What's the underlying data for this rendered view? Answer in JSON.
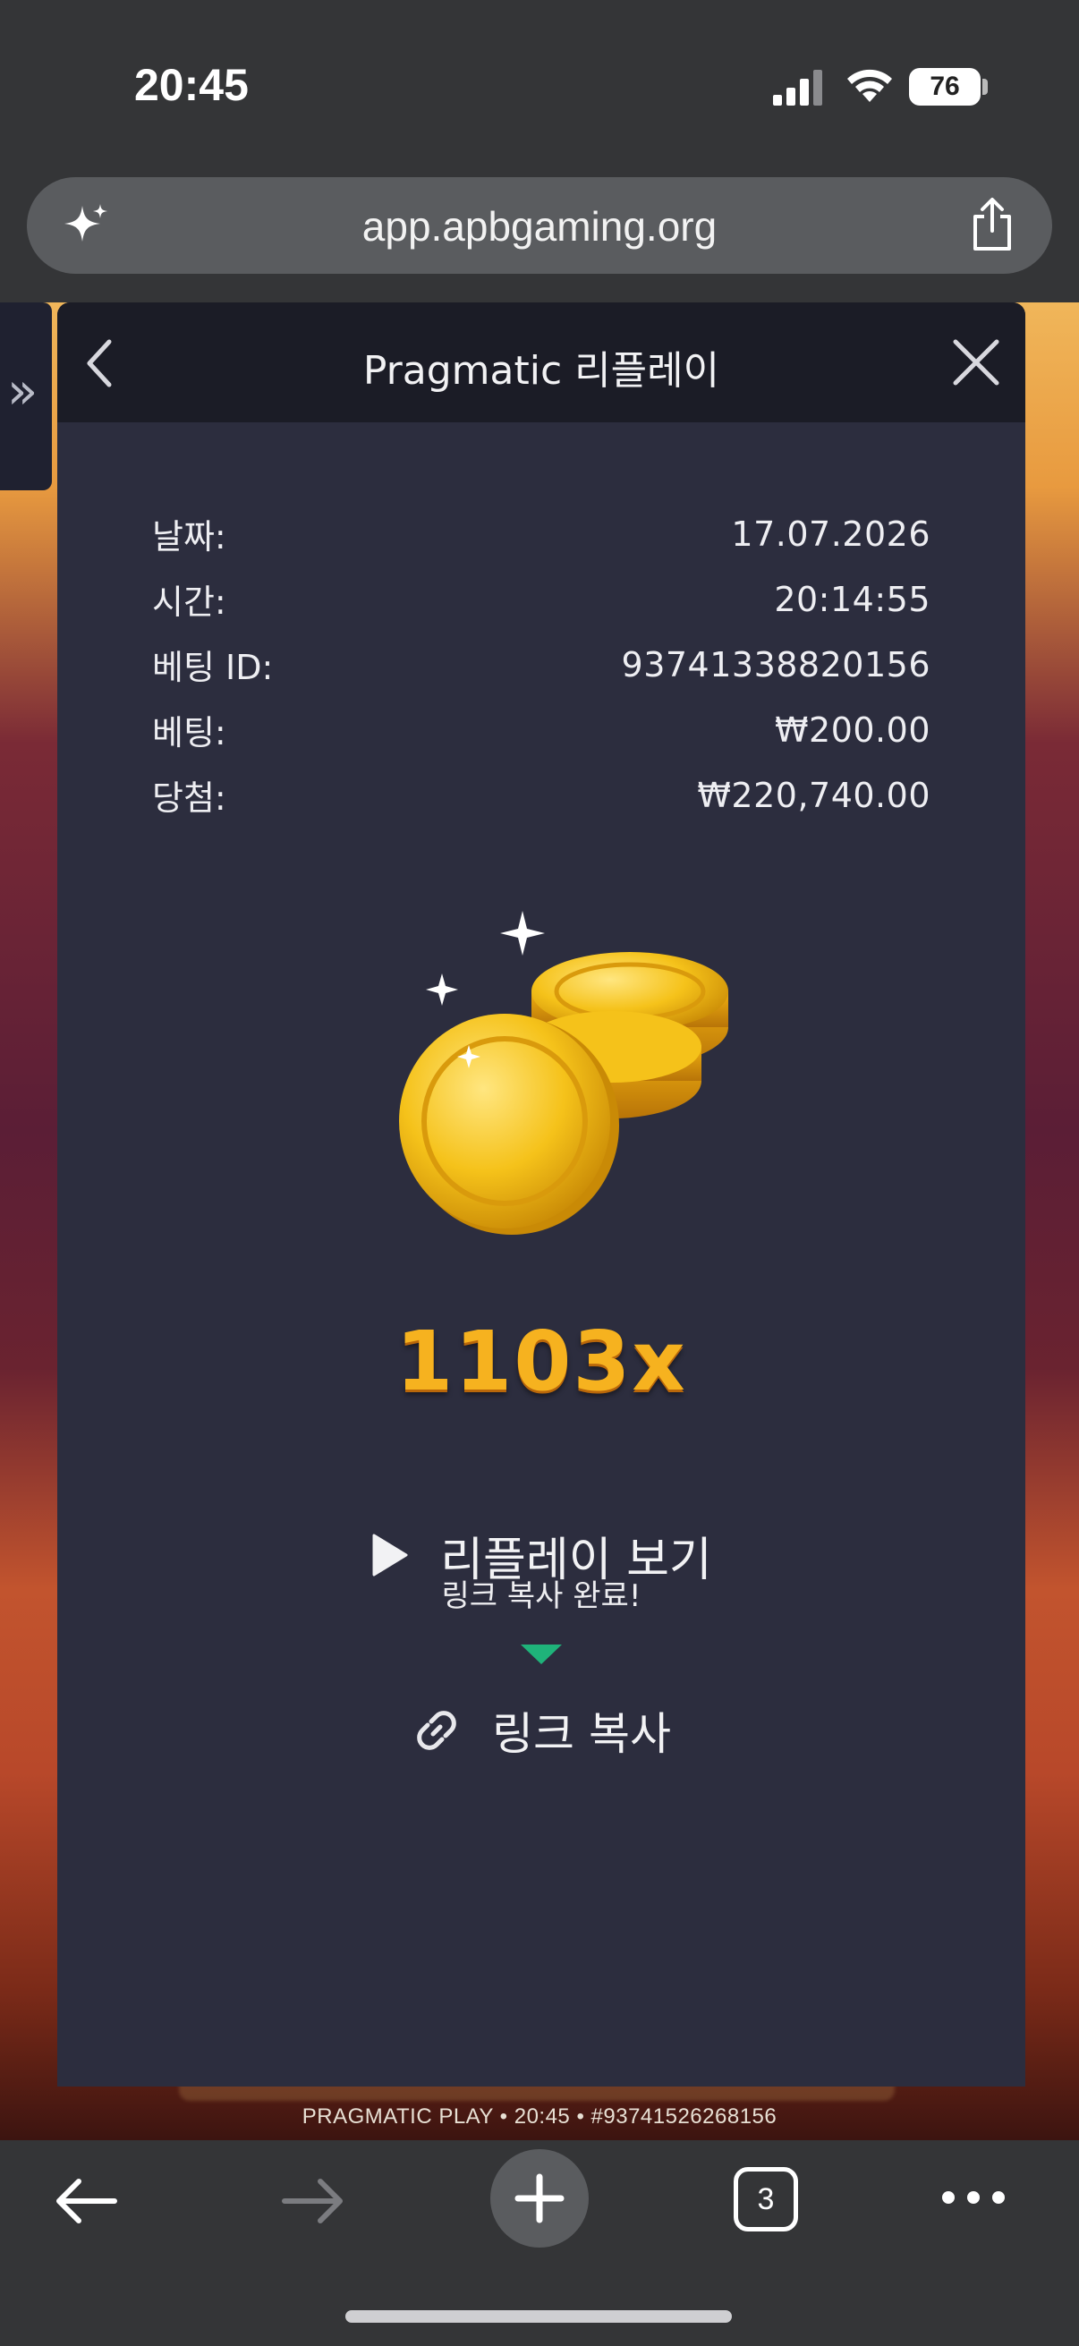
{
  "status_bar": {
    "time": "20:45",
    "battery": "76"
  },
  "browser": {
    "url": "app.apbgaming.org",
    "tab_count": "3"
  },
  "background_footer": "PRAGMATIC PLAY • 20:45 • #93741526268156",
  "modal": {
    "title": "Pragmatic 리플레이",
    "rows": [
      {
        "label": "날짜:",
        "value": "17.07.2026"
      },
      {
        "label": "시간:",
        "value": "20:14:55"
      },
      {
        "label": "베팅 ID:",
        "value": "93741338820156"
      },
      {
        "label": "베팅:",
        "value": "₩200.00"
      },
      {
        "label": "당첨:",
        "value": "₩220,740.00"
      }
    ],
    "multiplier": "1103x",
    "replay_label": "리플레이 보기",
    "toast": "링크 복사 완료!",
    "copy_link_label": "링크 복사"
  },
  "colors": {
    "modal_bg": "#2c2d3e",
    "modal_header_bg": "#1b1c26",
    "multiplier_gold": "#f6b21f",
    "toast_arrow": "#1fb37a"
  },
  "icons": {
    "url_left": "sparkle-icon",
    "url_right": "share-icon",
    "modal_left": "chevron-left-icon",
    "modal_right": "close-icon",
    "replay": "play-icon",
    "copy": "link-icon"
  }
}
